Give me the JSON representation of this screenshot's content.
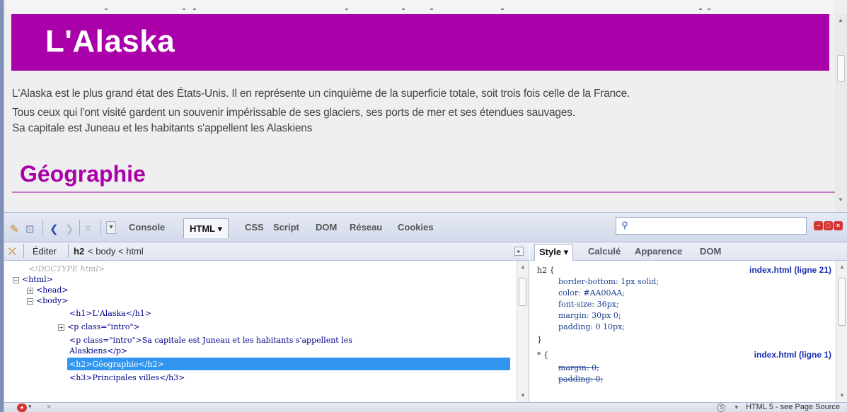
{
  "page": {
    "title": "L'Alaska",
    "intro_lines": [
      "L'Alaska est le plus grand état des États-Unis. Il en représente un cinquième de la superficie totale, soit trois fois celle de la France.",
      "Tous ceux qui l'ont visité gardent un souvenir impérissable de ses glaciers, ses ports de mer et ses étendues sauvages.",
      "Sa capitale est Juneau et les habitants s'appellent les Alaskiens"
    ],
    "h2": "Géographie",
    "colors": {
      "accent": "#AA00AA",
      "h2_line": "#c27bc2"
    }
  },
  "firebug": {
    "tabs": [
      "Console",
      "HTML ▾",
      "CSS",
      "Script",
      "DOM",
      "Réseau",
      "Cookies"
    ],
    "active_tab": "HTML ▾",
    "search": {
      "placeholder": "",
      "value": ""
    },
    "breadcrumb": {
      "edit_label": "Éditer",
      "current": "h2",
      "rest": "< body < html"
    },
    "html_tree": [
      {
        "text": "<!DOCTYPE html>"
      },
      {
        "text": "<html>"
      },
      {
        "text": "<head>"
      },
      {
        "text": "<body>"
      },
      {
        "text": "<h1>L'Alaska</h1>"
      },
      {
        "text": "<p class=\"intro\">"
      },
      {
        "text": "<p class=\"intro\">Sa capitale est Juneau et les habitants s'appellent les"
      },
      {
        "text": "Alaskiens</p>"
      },
      {
        "text": "<h2>Géographie</h2>",
        "selected": true
      },
      {
        "text": "<h3>Principales villes</h3>"
      }
    ],
    "style_tabs": [
      "Style ▾",
      "Calculé",
      "Apparence",
      "DOM"
    ],
    "active_style_tab": "Style ▾",
    "css_rules": [
      {
        "selector": "h2 {",
        "source": "index.html (ligne 21)",
        "declarations": [
          "border-bottom: 1px solid;",
          "color: #AA00AA;",
          "font-size: 36px;",
          "margin: 30px 0;",
          "padding: 0 10px;"
        ],
        "close": "}"
      },
      {
        "selector": "* {",
        "source": "index.html (ligne 1)",
        "declarations": [
          "margin: 0;",
          "padding: 0;"
        ]
      }
    ],
    "status": {
      "close": "×",
      "right_text": "HTML 5 - see Page Source"
    }
  }
}
